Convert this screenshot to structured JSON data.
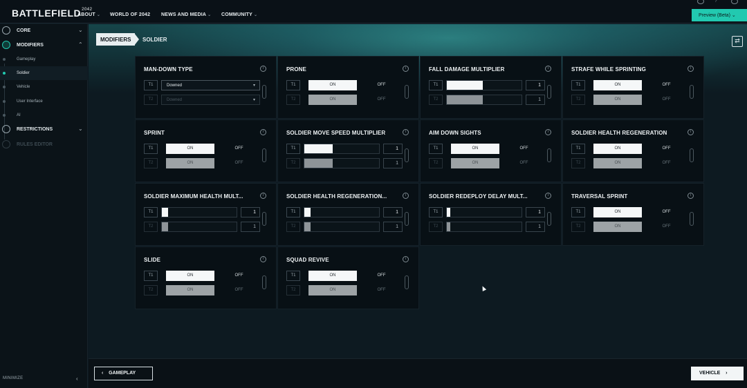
{
  "topbar": {
    "logo": "BATTLEFIELD",
    "logo_suffix": "2042",
    "nav": [
      {
        "label": "ABOUT"
      },
      {
        "label": "WORLD OF 2042"
      },
      {
        "label": "NEWS AND MEDIA"
      },
      {
        "label": "COMMUNITY"
      }
    ],
    "preview_button": "Preview (Beta) ⌄"
  },
  "sidebar": {
    "sections": [
      {
        "label": "CORE"
      },
      {
        "label": "MODIFIERS"
      },
      {
        "label": "RESTRICTIONS"
      },
      {
        "label": "RULES EDITOR"
      }
    ],
    "modifier_items": [
      {
        "label": "Gameplay"
      },
      {
        "label": "Soldier"
      },
      {
        "label": "Vehicle"
      },
      {
        "label": "User Interface"
      },
      {
        "label": "AI"
      }
    ],
    "minimize_label": "MINIMIZE"
  },
  "breadcrumb": {
    "section": "MODIFIERS",
    "page": "SOLDIER"
  },
  "common": {
    "t1": "T1",
    "t2": "T2",
    "on": "ON",
    "off": "OFF",
    "info": "i"
  },
  "cards": [
    {
      "title": "MAN-DOWN TYPE",
      "type": "select",
      "t1_value": "Downed",
      "t2_value": "Downed"
    },
    {
      "title": "PRONE",
      "type": "toggle"
    },
    {
      "title": "FALL DAMAGE MULTIPLIER",
      "type": "slider",
      "t1_value": "1",
      "t2_value": "1",
      "fill": 0.48
    },
    {
      "title": "STRAFE WHILE SPRINTING",
      "type": "toggle"
    },
    {
      "title": "SPRINT",
      "type": "toggle"
    },
    {
      "title": "SOLDIER MOVE SPEED MULTIPLIER",
      "type": "slider",
      "t1_value": "1",
      "t2_value": "1",
      "fill": 0.38
    },
    {
      "title": "AIM DOWN SIGHTS",
      "type": "toggle"
    },
    {
      "title": "SOLDIER HEALTH REGENERATION",
      "type": "toggle"
    },
    {
      "title": "SOLDIER MAXIMUM HEALTH MULT...",
      "type": "slider",
      "t1_value": "1",
      "t2_value": "1",
      "fill": 0.08
    },
    {
      "title": "SOLDIER HEALTH REGENERATION...",
      "type": "slider",
      "t1_value": "1",
      "t2_value": "1",
      "fill": 0.08
    },
    {
      "title": "SOLDIER REDEPLOY DELAY MULT...",
      "type": "slider",
      "t1_value": "1",
      "t2_value": "1",
      "fill": 0.05
    },
    {
      "title": "TRAVERSAL SPRINT",
      "type": "toggle"
    },
    {
      "title": "SLIDE",
      "type": "toggle"
    },
    {
      "title": "SQUAD REVIVE",
      "type": "toggle"
    }
  ],
  "footer": {
    "prev_label": "GAMEPLAY",
    "next_label": "VEHICLE"
  },
  "colors": {
    "accent": "#22c9b0",
    "background": "#0d1820",
    "card": "#081015"
  }
}
